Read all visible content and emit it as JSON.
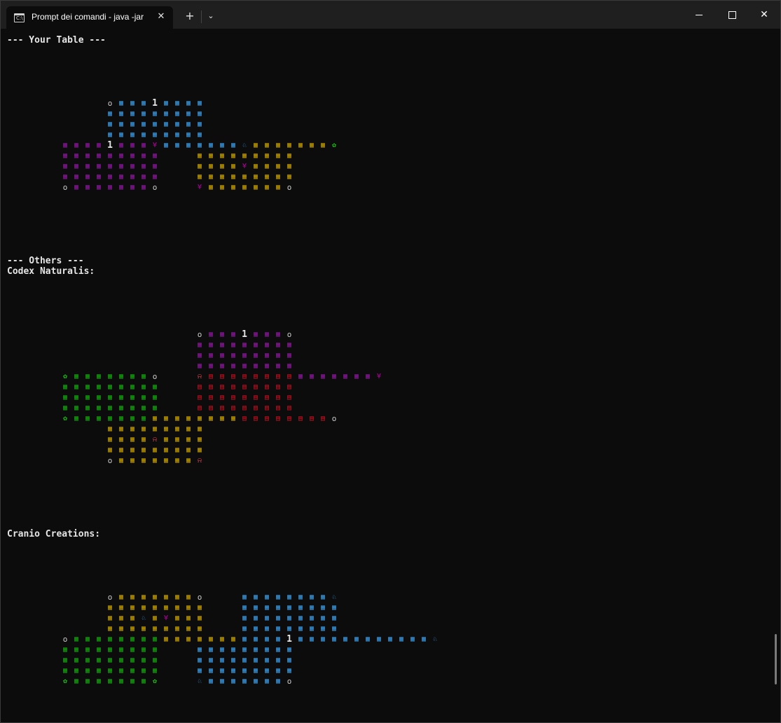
{
  "window": {
    "tab_title": "Prompt dei comandi - java  -jar",
    "tab_icon": "terminal-icon",
    "tab_icon_text": "C:\\",
    "close_tab": "✕",
    "new_tab": "+",
    "dropdown": "⌄",
    "minimize": "minimize-icon",
    "maximize": "maximize-icon",
    "close": "✕"
  },
  "console": {
    "header_your_table": "--- Your Table ---",
    "header_others": "--- Others ---",
    "player1": "Codex Naturalis:",
    "player2": "Cranio Creations:"
  },
  "glyphs": {
    "o": {
      "ch": "o",
      "color": "#cccccc"
    },
    "1": {
      "ch": "1",
      "color": "#e6e6e6"
    },
    "b": {
      "ch": "▦",
      "color": "#3a96dd"
    },
    "p": {
      "ch": "▦",
      "color": "#881798"
    },
    "y": {
      "ch": "▦",
      "color": "#c19c00"
    },
    "g": {
      "ch": "▦",
      "color": "#13a10e"
    },
    "r": {
      "ch": "▤",
      "color": "#c50f1f"
    },
    "W": {
      "ch": "¥",
      "color": "#b4009e"
    },
    "F": {
      "ch": "✿",
      "color": "#16c60c"
    },
    "H": {
      "ch": "♘",
      "color": "#3a96dd"
    },
    "M": {
      "ch": "⍾",
      "color": "#e74856"
    }
  },
  "boards": [
    {
      "name": "your-table",
      "rows": [
        "             o b b b 1 b b b b",
        "             b b b b b b b b b",
        "             b b b b b b b b b",
        "             b b b b b b b b b",
        "     p p p p 1 p p p W b b b b b b b H y y y y y y y F",
        "     p p p p p p p p p       y y y y y y y y y",
        "     p p p p p p p p p       y y y y W y y y y",
        "     p p p p p p p p p       y y y y y y y y y",
        "     o p p p p p p p o       W y y y y y y y o"
      ]
    },
    {
      "name": "codex-naturalis",
      "rows": [
        "                             o p p p 1 p p p o",
        "                             p p p p p p p p p",
        "                             p p p p p p p p p",
        "                             p p p p p p p p p",
        "     F g g g g g g g o       M r r r r r r r r p p p p p p p W",
        "     g g g g g g g g g       r r r r r r r r r",
        "     g g g g g g g g g       r r r r r r r r r",
        "     g g g g g g g g g       r r r r r r r r r",
        "     F g g g g g g g y y y y y y y y r r r r r r r r o",
        "             y y y y y y y y y",
        "             y y y y M y y y y",
        "             y y y y y y y y y",
        "             o y y y y y y y M"
      ]
    },
    {
      "name": "cranio-creations",
      "rows": [
        "             o y y y y y y y o       b b b b b b b b H",
        "             y y y y y y y y y       b b b b b b b b b",
        "             y y y H y W y y y       b b b b b b b b b",
        "             y y y y y y y y y       b b b b b b b b b",
        "     o g g g g g g g g y y y y y y y b b b b 1 b b b b b b b b b b b b H",
        "     g g g g g g g g g       b b b b b b b b b",
        "     g g g g g g g g g       b b b b b b b b b",
        "     g g g g g g g g g       b b b b b b b b b",
        "     F g g g g g g g F       H b b b b b b b o"
      ]
    }
  ]
}
